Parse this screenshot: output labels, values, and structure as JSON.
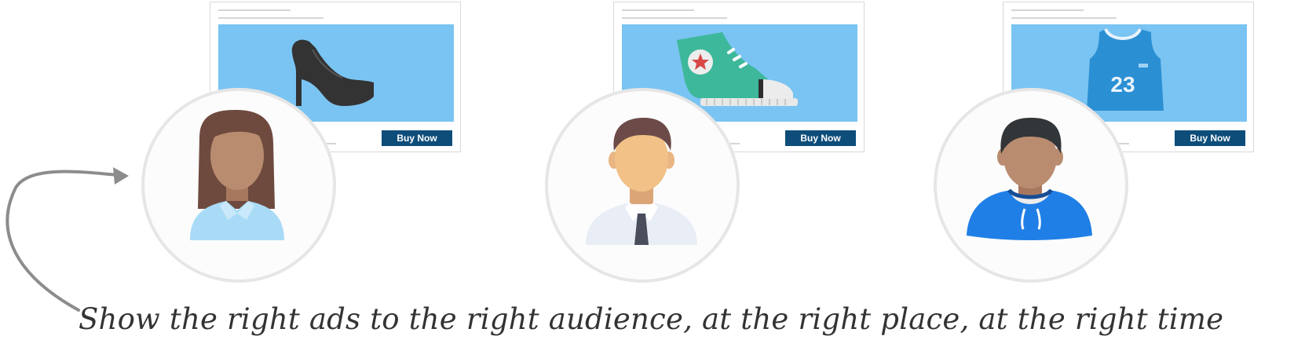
{
  "ads": [
    {
      "product": "high-heel-shoe-icon",
      "button_label": "Buy Now"
    },
    {
      "product": "sneaker-icon",
      "button_label": "Buy Now"
    },
    {
      "product": "basketball-jersey-icon",
      "button_label": "Buy Now",
      "jersey_number": "23"
    }
  ],
  "audience": [
    {
      "avatar": "woman-avatar-icon"
    },
    {
      "avatar": "businessman-avatar-icon"
    },
    {
      "avatar": "young-man-hoodie-avatar-icon"
    }
  ],
  "tagline": "Show the right ads to the right audience, at the right place, at the right time",
  "colors": {
    "banner": "#79c4f2",
    "button": "#0e4d7a",
    "circle_border": "#e6e6e6",
    "arrow": "#8c8c8c"
  }
}
